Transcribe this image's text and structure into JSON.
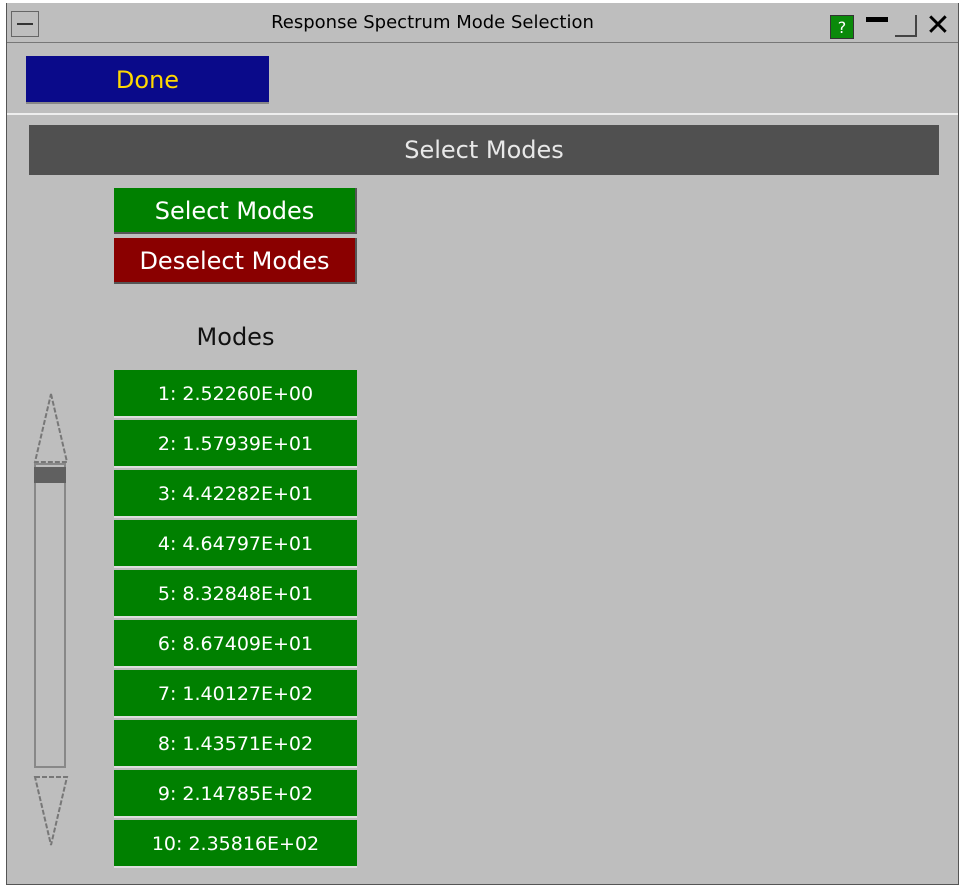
{
  "window": {
    "title": "Response Spectrum Mode Selection"
  },
  "titlebar": {
    "help_label": "?"
  },
  "toolbar": {
    "done_label": "Done"
  },
  "section": {
    "header": "Select Modes"
  },
  "actions": {
    "select_label": "Select Modes",
    "deselect_label": "Deselect Modes"
  },
  "modes": {
    "label": "Modes",
    "items": [
      "1:  2.52260E+00",
      "2:  1.57939E+01",
      "3:  4.42282E+01",
      "4:  4.64797E+01",
      "5:  8.32848E+01",
      "6:  8.67409E+01",
      "7:  1.40127E+02",
      "8:  1.43571E+02",
      "9:  2.14785E+02",
      "10:  2.35816E+02"
    ]
  },
  "colors": {
    "window_bg": "#bebebe",
    "done_bg": "#0a0a8a",
    "done_text": "#ffd800",
    "header_bg": "#505050",
    "select_bg": "#008000",
    "deselect_bg": "#8a0000",
    "mode_bg": "#008000"
  }
}
